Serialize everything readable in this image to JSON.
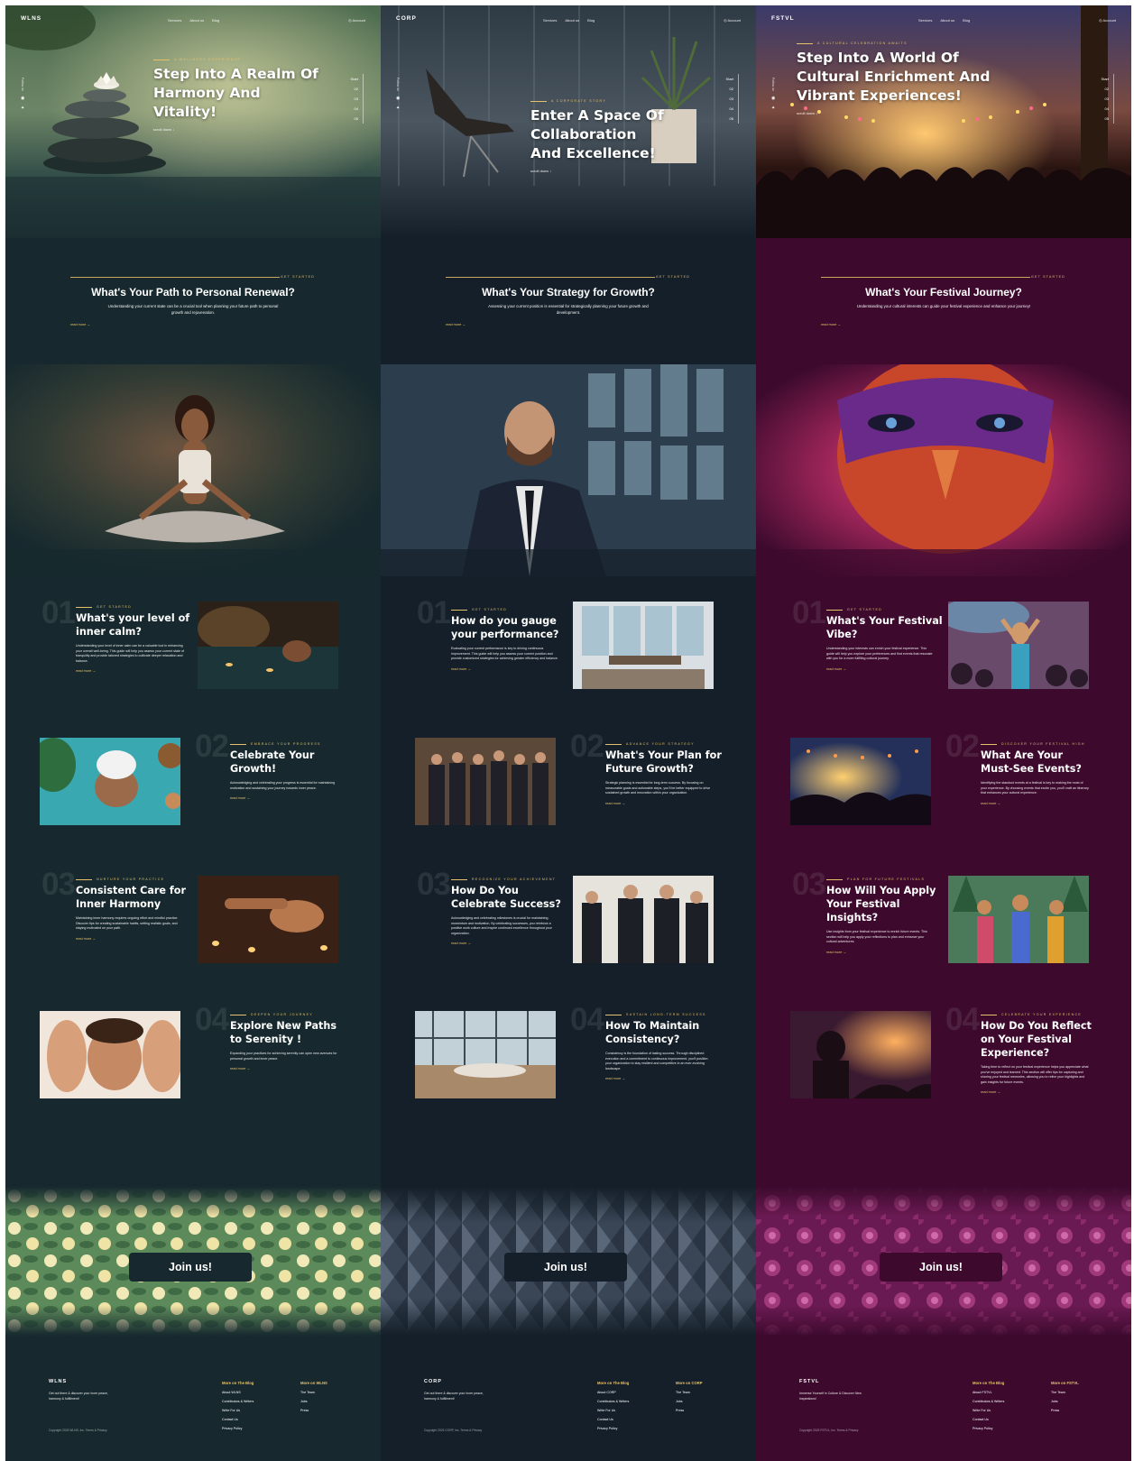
{
  "columns": [
    {
      "brand": "WLNS",
      "theme_bg": "#17292e",
      "accent": "#e6c16b",
      "nav": [
        "Services",
        "About us",
        "Blog"
      ],
      "account": "Account",
      "follow": "Follow us",
      "rail": [
        "Start",
        "02",
        "03",
        "04",
        "05"
      ],
      "hero": {
        "kicker": "A WELLNESS EXPERIENCE",
        "title": "Step Into A Realm Of Harmony And Vitality!",
        "scroll": "scroll down ↓"
      },
      "path": {
        "kicker": "GET STARTED",
        "title": "What's Your Path to Personal Renewal?",
        "sub": "Understanding your current state can be a crucial tool when planning your future path to personal growth and rejuvenation.",
        "read": "read more →"
      },
      "cards": [
        {
          "num": "01",
          "kicker": "GET STARTED",
          "title": "What's your level of inner calm?",
          "body": "Understanding your level of inner calm can be a valuable tool in enhancing your overall well-being. This guide will help you assess your current state of tranquility and provide tailored strategies to cultivate deeper relaxation and balance.",
          "read": "read more →",
          "image": "spa-pool-image"
        },
        {
          "num": "02",
          "kicker": "EMBRACE YOUR PROGRESS",
          "title": "Celebrate Your Growth!",
          "body": "Acknowledging and celebrating your progress is essential for maintaining motivation and sustaining your journey towards inner peace.",
          "read": "read more →",
          "image": "spa-towel-image"
        },
        {
          "num": "03",
          "kicker": "NURTURE YOUR PRACTICE",
          "title": "Consistent Care for Inner Harmony",
          "body": "Maintaining inner harmony requires ongoing effort and mindful practice. Discover tips for creating sustainable habits, setting realistic goals, and staying motivated on your path.",
          "read": "read more →",
          "image": "massage-candles-image"
        },
        {
          "num": "04",
          "kicker": "DEEPEN YOUR JOURNEY",
          "title": "Explore New Paths to Serenity !",
          "body": "Expanding your practices for achieving serenity can open new avenues for personal growth and inner peace.",
          "read": "read more →",
          "image": "facial-image"
        }
      ],
      "join": "Join us!",
      "footer": {
        "brand": "WLNS",
        "tag": "Get out there & discover your inner peace, harmony & fulfillment!",
        "blog_head": "More on The Blog",
        "blog": [
          "About WLNS",
          "Contributors & Writers",
          "Write For Us",
          "Contact Us",
          "Privacy Policy"
        ],
        "more_head": "More on WLNS",
        "more": [
          "The Team",
          "Jobs",
          "Press"
        ],
        "copyright": "Copyright 2023 WLNS, Inc. Terms & Privacy"
      }
    },
    {
      "brand": "CORP",
      "theme_bg": "#141f29",
      "accent": "#e6c16b",
      "nav": [
        "Services",
        "About us",
        "Blog"
      ],
      "account": "Account",
      "follow": "Follow us",
      "rail": [
        "Start",
        "02",
        "03",
        "04",
        "05"
      ],
      "hero": {
        "kicker": "A CORPORATE STORY",
        "title": "Enter A Space Of Collaboration And Excellence!",
        "scroll": "scroll down ↓"
      },
      "path": {
        "kicker": "GET STARTED",
        "title": "What's Your Strategy for Growth?",
        "sub": "Assessing your current position is essential for strategically planning your future growth and development.",
        "read": "read more →"
      },
      "cards": [
        {
          "num": "01",
          "kicker": "GET STARTED",
          "title": "How do you gauge your performance?",
          "body": "Evaluating your current performance is key to driving continuous improvement. This guide will help you assess your current position and provide customized strategies for achieving greater efficiency and balance.",
          "read": "read more →",
          "image": "office-image"
        },
        {
          "num": "02",
          "kicker": "ADVANCE YOUR STRATEGY",
          "title": "What's Your Plan for Future Growth?",
          "body": "Strategic planning is essential for long-term success. By focusing on measurable goals and actionable steps, you'll be better equipped to drive sustained growth and innovation within your organization.",
          "read": "read more →",
          "image": "team-image"
        },
        {
          "num": "03",
          "kicker": "RECOGNIZE YOUR ACHIEVEMENT",
          "title": "How Do You Celebrate Success?",
          "body": "Acknowledging and celebrating milestones is crucial for maintaining momentum and motivation. By celebrating successes, you reinforce a positive work culture and inspire continued excellence throughout your organization.",
          "read": "read more →",
          "image": "handshake-image"
        },
        {
          "num": "04",
          "kicker": "SUSTAIN LONG-TERM SUCCESS",
          "title": "How To Maintain Consistency?",
          "body": "Consistency is the foundation of lasting success. Through disciplined execution and a commitment to continuous improvement, you'll position your organization to stay resilient and competitive in an ever-evolving landscape.",
          "read": "read more →",
          "image": "meeting-room-image"
        }
      ],
      "join": "Join us!",
      "footer": {
        "brand": "CORP",
        "tag": "Get out there & discover your inner peace, harmony & fulfillment!",
        "blog_head": "More on The Blog",
        "blog": [
          "About CORP",
          "Contributors & Writers",
          "Write For Us",
          "Contact Us",
          "Privacy Policy"
        ],
        "more_head": "More on CORP",
        "more": [
          "The Team",
          "Jobs",
          "Press"
        ],
        "copyright": "Copyright 2023 CORP, Inc. Terms & Privacy"
      }
    },
    {
      "brand": "FSTVL",
      "theme_bg": "#3d0a2e",
      "accent": "#e6c16b",
      "nav": [
        "Services",
        "About us",
        "Blog"
      ],
      "account": "Account",
      "follow": "Follow us",
      "rail": [
        "Start",
        "02",
        "03",
        "04",
        "05"
      ],
      "hero": {
        "kicker": "A CULTURAL CELEBRATION AWAITS",
        "title": "Step Into A World Of Cultural Enrichment And Vibrant Experiences!",
        "scroll": "scroll down ↓"
      },
      "path": {
        "kicker": "GET STARTED",
        "title": "What's Your Festival Journey?",
        "sub": "Understanding your cultural interests can guide your festival experience and enhance your journey!",
        "read": "read more →"
      },
      "cards": [
        {
          "num": "01",
          "kicker": "GET STARTED",
          "title": "What's Your Festival Vibe?",
          "body": "Understanding your interests can enrich your festival experience. This guide will help you explore your preferences and find events that resonate with you for a more fulfilling cultural journey.",
          "read": "read more →",
          "image": "dancer-image"
        },
        {
          "num": "02",
          "kicker": "DISCOVER YOUR FESTIVAL HIGH",
          "title": "What Are Your Must-See Events?",
          "body": "Identifying the standout events at a festival is key to making the most of your experience. By choosing events that excite you, you'll craft an itinerary that enhances your cultural experience.",
          "read": "read more →",
          "image": "concert-lights-image"
        },
        {
          "num": "03",
          "kicker": "PLAN FOR FUTURE FESTIVALS",
          "title": "How Will You Apply Your Festival Insights?",
          "body": "Use insights from your festival experience to enrich future events. This section will help you apply your reflections to plan and enhance your cultural adventures.",
          "read": "read more →",
          "image": "musicians-image"
        },
        {
          "num": "04",
          "kicker": "CELEBRATE YOUR EXPERIENCE",
          "title": "How Do You Reflect on Your Festival Experience?",
          "body": "Taking time to reflect on your festival experience helps you appreciate what you've enjoyed and learned. This section will offer tips for capturing and sharing your festival memories, allowing you to relive your highlights and gain insights for future events.",
          "read": "read more →",
          "image": "festival-crowd-image"
        }
      ],
      "join": "Join us!",
      "footer": {
        "brand": "FSTVL",
        "tag": "Immerse Yourself in Culture & Discover New Inspirations!",
        "blog_head": "More on The Blog",
        "blog": [
          "About FSTVL",
          "Contributors & Writers",
          "Write For Us",
          "Contact Us",
          "Privacy Policy"
        ],
        "more_head": "More on FSTVL",
        "more": [
          "The Team",
          "Jobs",
          "Press"
        ],
        "copyright": "Copyright 2023 FSTVL, Inc. Terms & Privacy"
      }
    }
  ]
}
